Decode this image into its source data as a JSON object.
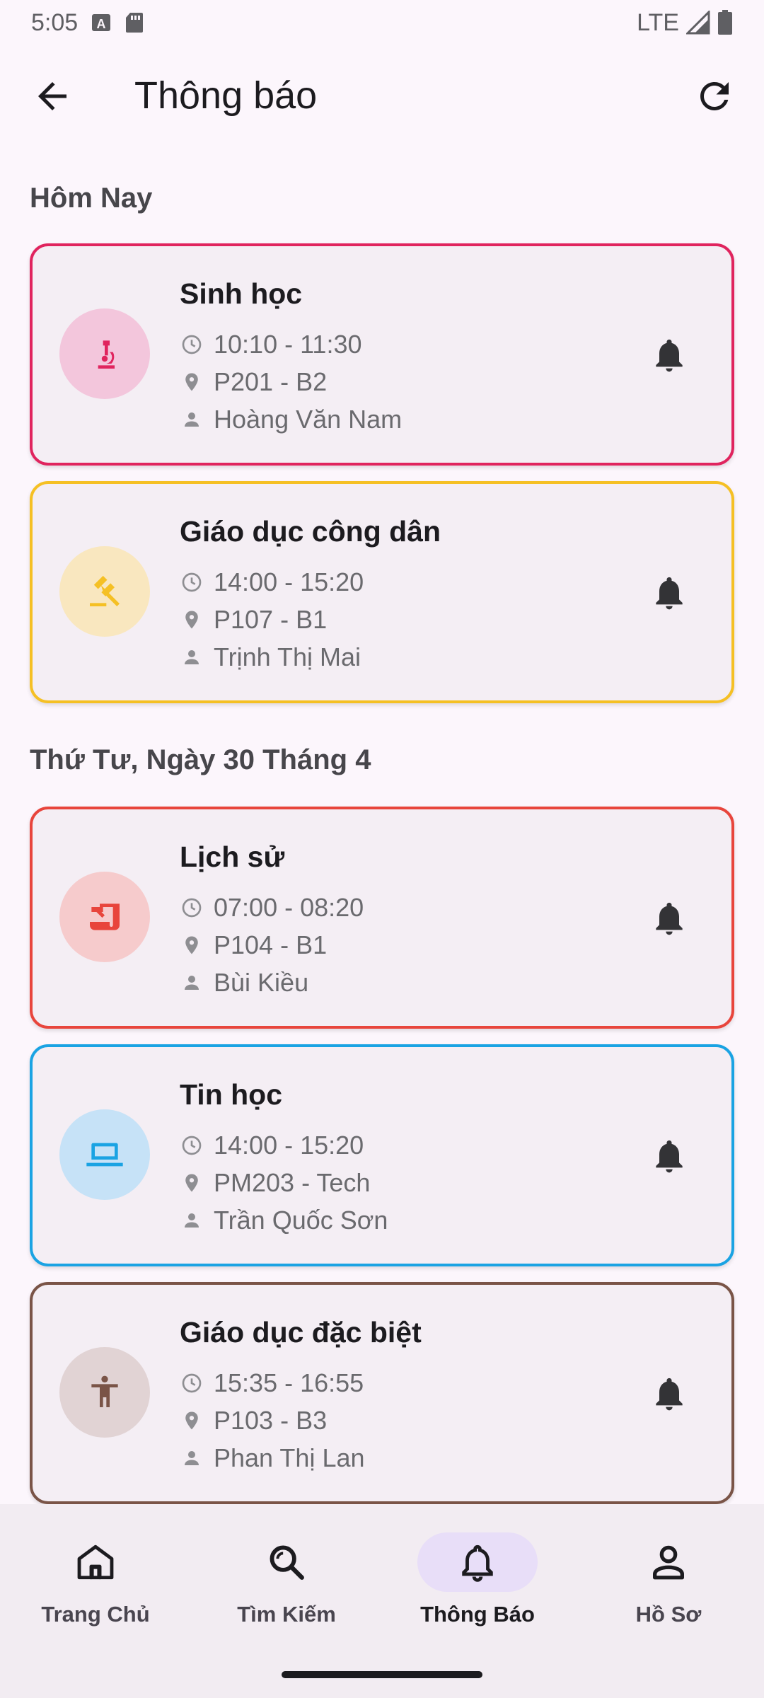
{
  "status_bar": {
    "time": "5:05",
    "network": "LTE"
  },
  "app_bar": {
    "title": "Thông báo",
    "back_icon": "arrow-back-icon",
    "refresh_icon": "refresh-icon"
  },
  "sections": [
    {
      "header": "Hôm Nay",
      "cards": [
        {
          "subject": "Sinh học",
          "time": "10:10 - 11:30",
          "room": "P201 - B2",
          "teacher": "Hoàng Văn Nam",
          "accent": "#e0245e",
          "tint": "#f3c6dc",
          "icon": "microscope-icon"
        },
        {
          "subject": "Giáo dục công dân",
          "time": "14:00 - 15:20",
          "room": "P107 - B1",
          "teacher": "Trịnh Thị Mai",
          "accent": "#f5c024",
          "tint": "#f9e7bf",
          "icon": "gavel-icon"
        }
      ]
    },
    {
      "header": "Thứ Tư, Ngày 30 Tháng 4",
      "cards": [
        {
          "subject": "Lịch sử",
          "time": "07:00 - 08:20",
          "room": "P104 - B1",
          "teacher": "Bùi Kiều",
          "accent": "#e8453c",
          "tint": "#f6cbcc",
          "icon": "history-edu-icon"
        },
        {
          "subject": "Tin học",
          "time": "14:00 - 15:20",
          "room": "PM203 - Tech",
          "teacher": "Trần Quốc Sơn",
          "accent": "#1aa3e3",
          "tint": "#c6e2f7",
          "icon": "laptop-icon"
        },
        {
          "subject": "Giáo dục đặc biệt",
          "time": "15:35 - 16:55",
          "room": "P103 - B3",
          "teacher": "Phan Thị Lan",
          "accent": "#7a5447",
          "tint": "#e1d3d4",
          "icon": "accessibility-icon"
        }
      ]
    }
  ],
  "bottom_nav": [
    {
      "label": "Trang Chủ",
      "icon": "home-icon",
      "active": false
    },
    {
      "label": "Tìm Kiếm",
      "icon": "search-icon",
      "active": false
    },
    {
      "label": "Thông Báo",
      "icon": "bell-icon",
      "active": true
    },
    {
      "label": "Hồ Sơ",
      "icon": "person-icon",
      "active": false
    }
  ]
}
